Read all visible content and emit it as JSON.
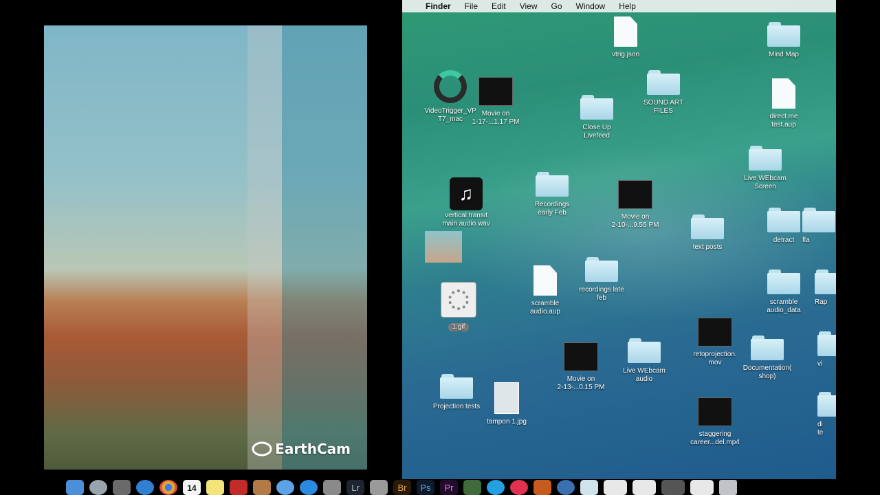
{
  "earthcam": {
    "logo_text": "EarthCam"
  },
  "menubar": {
    "apple_glyph": "",
    "items": [
      "Finder",
      "File",
      "Edit",
      "View",
      "Go",
      "Window",
      "Help"
    ]
  },
  "desktop_items": [
    {
      "label": "vtrig.json"
    },
    {
      "label": "Mind Map"
    },
    {
      "label": "VideoTrigger_VP\nT7_mac"
    },
    {
      "label": "Movie on\n1-17-...1.17 PM"
    },
    {
      "label": "SOUND ART\nFILES"
    },
    {
      "label": "Close Up\nLivefeed"
    },
    {
      "label": "direct me\ntest.aup"
    },
    {
      "label": "Live WEbcam\nScreen"
    },
    {
      "label": "vertical transit\nmain audio.wav"
    },
    {
      "label": "Recordings\nearly Feb"
    },
    {
      "label": "Movie on\n2-10-...9.55 PM"
    },
    {
      "label": "text posts"
    },
    {
      "label": "detract"
    },
    {
      "label": "fla"
    },
    {
      "label": "scramble\naudio.aup"
    },
    {
      "label": "recordings late\nfeb"
    },
    {
      "label": "scramble\naudio_data"
    },
    {
      "label": "Rap"
    },
    {
      "label": "1.gif"
    },
    {
      "label": "retoprojection.\nmov"
    },
    {
      "label": "Movie on\n2-13-...0.15 PM"
    },
    {
      "label": "Live WEbcam\naudio"
    },
    {
      "label": "Documentation(\nshop)"
    },
    {
      "label": "vi"
    },
    {
      "label": "Projection tests"
    },
    {
      "label": "tampon 1.jpg"
    },
    {
      "label": "staggering\ncareer...del.mp4"
    },
    {
      "label": "di\nte"
    }
  ],
  "dock": {
    "icons": [
      "finder-icon",
      "launchpad-icon",
      "photo-icon",
      "safari-icon",
      "chrome-icon",
      "calendar-icon",
      "stickies-icon",
      "photobooth-icon",
      "preview-icon",
      "mail-icon",
      "appstore-icon",
      "iphoto-icon",
      "lightroom-icon",
      "calculator-icon",
      "bridge-icon",
      "photoshop-icon",
      "premiere-icon",
      "facetime-icon",
      "skype-icon",
      "itunes-icon",
      "audacity-icon",
      "systemprefs-icon",
      "folder-icon",
      "window-icon",
      "window-icon",
      "window-icon",
      "window-icon",
      "trash-icon"
    ],
    "calendar_day": "14",
    "lightroom_text": "Lr",
    "bridge_text": "Br",
    "photoshop_text": "Ps",
    "premiere_text": "Pr"
  }
}
